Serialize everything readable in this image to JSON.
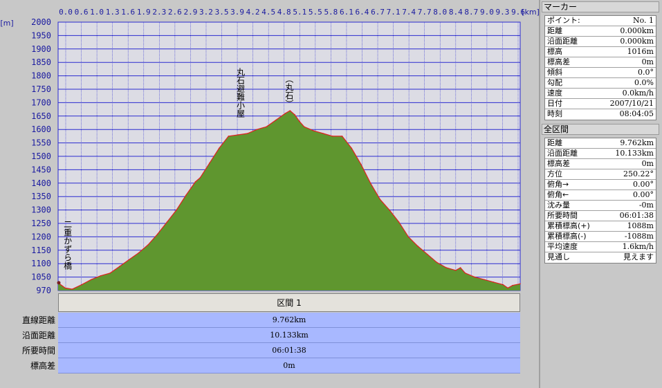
{
  "chart_data": {
    "type": "area",
    "xunit": "[km]",
    "yunit": "[m]",
    "xlim": [
      0,
      9.762
    ],
    "ylim": [
      970,
      2000
    ],
    "x_ticks": [
      "0.0",
      "0.6",
      "1.0",
      "1.3",
      "1.6",
      "1.9",
      "2.3",
      "2.6",
      "2.9",
      "3.2",
      "3.5",
      "3.9",
      "4.2",
      "4.5",
      "4.8",
      "5.1",
      "5.5",
      "5.8",
      "6.1",
      "6.4",
      "6.7",
      "7.1",
      "7.4",
      "7.7",
      "8.0",
      "8.4",
      "8.7",
      "9.0",
      "9.3",
      "9.6"
    ],
    "y_ticks": [
      "2000",
      "1950",
      "1900",
      "1850",
      "1800",
      "1750",
      "1700",
      "1650",
      "1600",
      "1550",
      "1500",
      "1450",
      "1400",
      "1350",
      "1300",
      "1250",
      "1200",
      "1150",
      "1100",
      "1050",
      "970"
    ],
    "grid": true,
    "series": [
      {
        "x": [
          0.0,
          0.15,
          0.3,
          0.5,
          0.7,
          0.9,
          1.1,
          1.3,
          1.5,
          1.7,
          1.9,
          2.1,
          2.3,
          2.5,
          2.7,
          2.9,
          3.0,
          3.2,
          3.4,
          3.6,
          3.8,
          4.0,
          4.2,
          4.4,
          4.6,
          4.8,
          4.9,
          5.0,
          5.1,
          5.2,
          5.4,
          5.6,
          5.8,
          6.0,
          6.2,
          6.4,
          6.6,
          6.8,
          7.0,
          7.2,
          7.4,
          7.6,
          7.8,
          8.0,
          8.2,
          8.4,
          8.5,
          8.6,
          8.8,
          9.0,
          9.2,
          9.4,
          9.5,
          9.6,
          9.762
        ],
        "y": [
          1016,
          985,
          978,
          1005,
          1035,
          1055,
          1065,
          1090,
          1115,
          1140,
          1170,
          1210,
          1255,
          1300,
          1355,
          1405,
          1420,
          1475,
          1530,
          1575,
          1580,
          1585,
          1600,
          1610,
          1635,
          1660,
          1670,
          1655,
          1630,
          1610,
          1595,
          1585,
          1575,
          1575,
          1530,
          1470,
          1400,
          1340,
          1300,
          1255,
          1200,
          1165,
          1135,
          1105,
          1085,
          1075,
          1085,
          1065,
          1050,
          1035,
          1020,
          1005,
          985,
          1000,
          1010
        ]
      }
    ],
    "annotations": [
      {
        "text": "丸石避難小屋",
        "x": 3.85
      },
      {
        "text": "（丸石）",
        "x": 4.88
      },
      {
        "text": "二重かずら橋",
        "x": 0.2
      }
    ]
  },
  "section": {
    "header": "区間 1",
    "rows": [
      {
        "label": "直線距離",
        "value": "9.762km"
      },
      {
        "label": "沿面距離",
        "value": "10.133km"
      },
      {
        "label": "所要時間",
        "value": "06:01:38"
      },
      {
        "label": "標高差",
        "value": "0m"
      }
    ]
  },
  "marker": {
    "title": "マーカー",
    "rows": [
      {
        "label": "ポイント:",
        "value": "No. 1"
      },
      {
        "label": "距離",
        "value": "0.000km"
      },
      {
        "label": "沿面距離",
        "value": "0.000km"
      },
      {
        "label": "標高",
        "value": "1016m"
      },
      {
        "label": "標高差",
        "value": "0m"
      },
      {
        "label": "傾斜",
        "value": "0.0°"
      },
      {
        "label": "勾配",
        "value": "0.0%"
      },
      {
        "label": "速度",
        "value": "0.0km/h"
      },
      {
        "label": "日付",
        "value": "2007/10/21"
      },
      {
        "label": "時刻",
        "value": "08:04:05"
      }
    ]
  },
  "whole": {
    "title": "全区間",
    "rows": [
      {
        "label": "距離",
        "value": "9.762km"
      },
      {
        "label": "沿面距離",
        "value": "10.133km"
      },
      {
        "label": "標高差",
        "value": "0m"
      },
      {
        "label": "方位",
        "value": "250.22°"
      },
      {
        "label": "俯角→",
        "value": "0.00°"
      },
      {
        "label": "俯角←",
        "value": "0.00°"
      },
      {
        "label": "沈み量",
        "value": "-0m"
      },
      {
        "label": "所要時間",
        "value": "06:01:38"
      },
      {
        "label": "累積標高(+)",
        "value": "1088m"
      },
      {
        "label": "累積標高(-)",
        "value": "-1088m"
      },
      {
        "label": "平均速度",
        "value": "1.6km/h"
      },
      {
        "label": "見通し",
        "value": "見えます"
      }
    ]
  },
  "colors": {
    "fill": "#5f962f",
    "line": "#e02020",
    "plotbg": "#dcdce4",
    "grid": "#2a2ad0",
    "axis_text": "#1a1aa0"
  }
}
